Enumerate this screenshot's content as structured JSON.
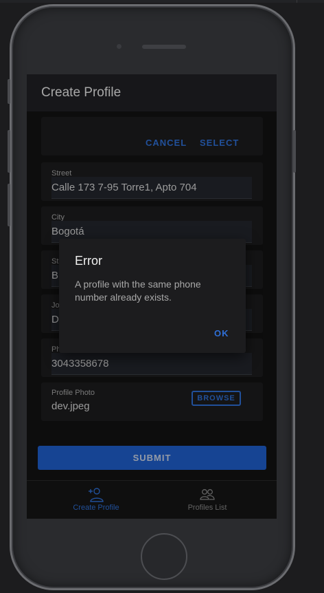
{
  "app": {
    "title": "Create Profile"
  },
  "picker": {
    "cancel_label": "CANCEL",
    "select_label": "SELECT"
  },
  "form": {
    "street": {
      "label": "Street",
      "value": "Calle 173 7-95 Torre1, Apto 704"
    },
    "city": {
      "label": "City",
      "value": "Bogotá"
    },
    "state": {
      "label_partial": "St",
      "value_partial": "B"
    },
    "job": {
      "label_partial": "Jo",
      "value_partial": "D"
    },
    "phone": {
      "label_partial": "Ph",
      "value": "3043358678"
    },
    "photo": {
      "label": "Profile Photo",
      "value": "dev.jpeg",
      "browse_label": "BROWSE"
    },
    "submit_label": "SUBMIT"
  },
  "tabs": [
    {
      "label": "Create Profile",
      "icon": "add-person-icon",
      "active": true
    },
    {
      "label": "Profiles List",
      "icon": "people-icon",
      "active": false
    }
  ],
  "dialog": {
    "title": "Error",
    "message": "A profile with the same phone number already exists.",
    "ok_label": "OK"
  },
  "colors": {
    "accent": "#2f6fd6",
    "submit_bg": "#1f5fcc",
    "tab_inactive": "#8a8a8a"
  }
}
